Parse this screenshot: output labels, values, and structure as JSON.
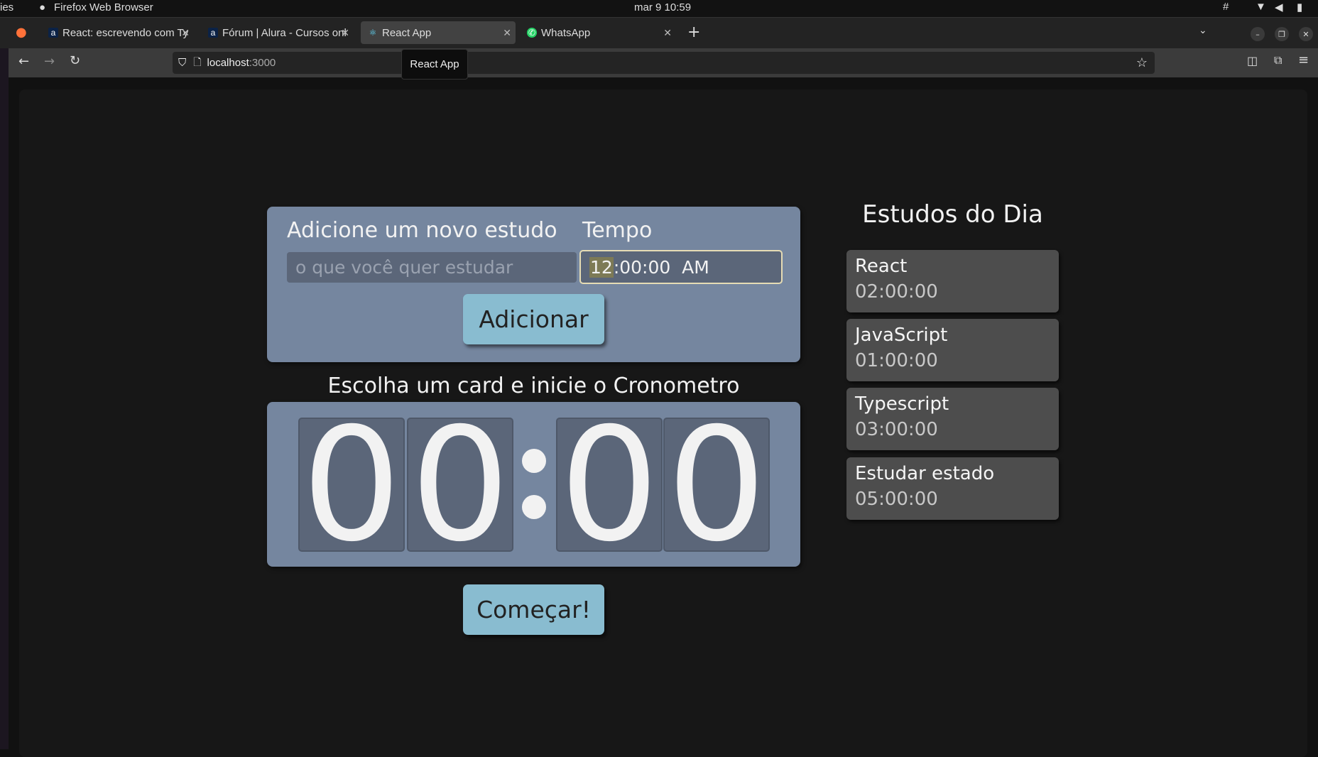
{
  "system": {
    "activities": "ies",
    "app_name": "Firefox Web Browser",
    "clock": "mar 9  10:59"
  },
  "tabs": [
    {
      "title": "React: escrevendo com Ty",
      "icon": "alura-icon",
      "active": false
    },
    {
      "title": "Fórum | Alura - Cursos onl",
      "icon": "alura-icon",
      "active": false
    },
    {
      "title": "React App",
      "icon": "react-icon",
      "active": true
    },
    {
      "title": "WhatsApp",
      "icon": "whatsapp-icon",
      "active": false
    }
  ],
  "url": {
    "host": "localhost",
    "port": ":3000"
  },
  "tooltip": "React App",
  "form": {
    "label_study": "Adicione um novo estudo",
    "label_time": "Tempo",
    "study_placeholder": "o que você quer estudar",
    "time_hour": "12",
    "time_rest": ":00:00  AM",
    "add_button": "Adicionar"
  },
  "timer": {
    "heading": "Escolha um card e inicie o Cronometro",
    "digits": [
      "0",
      "0",
      "0",
      "0"
    ],
    "start_button": "Começar!"
  },
  "list": {
    "title": "Estudos do Dia",
    "items": [
      {
        "name": "React",
        "time": "02:00:00"
      },
      {
        "name": "JavaScript",
        "time": "01:00:00"
      },
      {
        "name": "Typescript",
        "time": "03:00:00"
      },
      {
        "name": "Estudar estado",
        "time": "05:00:00"
      }
    ]
  },
  "colors": {
    "card": "#75869f",
    "button": "#89bcd0",
    "item": "#4d4d4d",
    "background": "#171717"
  }
}
